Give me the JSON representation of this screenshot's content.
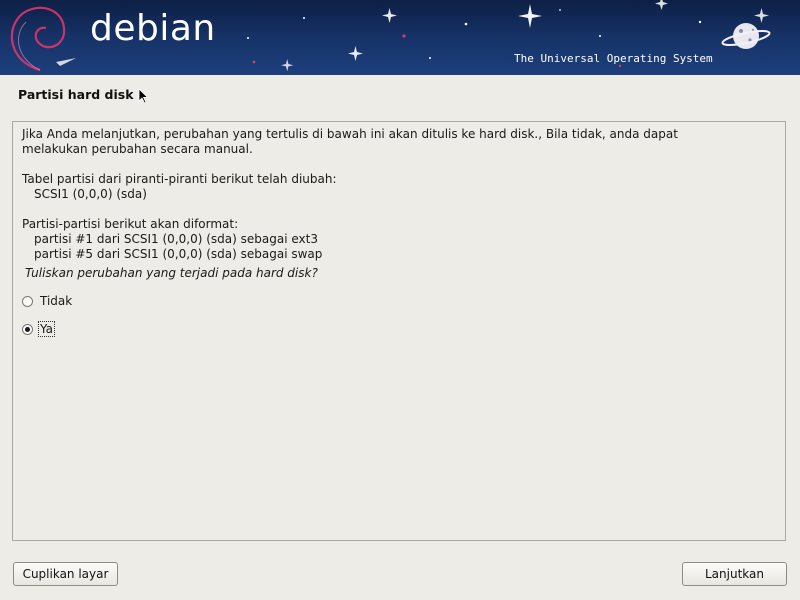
{
  "banner": {
    "logo_text": "debian",
    "tagline": "The Universal Operating System"
  },
  "page": {
    "title": "Partisi hard disk"
  },
  "content": {
    "intro_line1": "Jika Anda melanjutkan, perubahan yang tertulis di bawah ini akan ditulis ke hard disk., Bila tidak, anda dapat",
    "intro_line2": "melakukan perubahan secara manual.",
    "tables_heading": "Tabel partisi dari piranti-piranti berikut telah diubah:",
    "tables_item": "SCSI1 (0,0,0) (sda)",
    "format_heading": "Partisi-partisi berikut akan diformat:",
    "format_items": [
      "partisi #1 dari SCSI1 (0,0,0) (sda) sebagai ext3",
      "partisi #5 dari SCSI1 (0,0,0) (sda) sebagai swap"
    ],
    "question": "Tuliskan perubahan yang terjadi pada hard disk?"
  },
  "options": [
    {
      "label": "Tidak",
      "selected": false
    },
    {
      "label": "Ya",
      "selected": true
    }
  ],
  "buttons": {
    "screenshot": "Cuplikan layar",
    "continue": "Lanjutkan"
  },
  "icons": [
    "debian-swirl-icon",
    "planet-icon",
    "mouse-cursor-icon",
    "radio-icon"
  ]
}
